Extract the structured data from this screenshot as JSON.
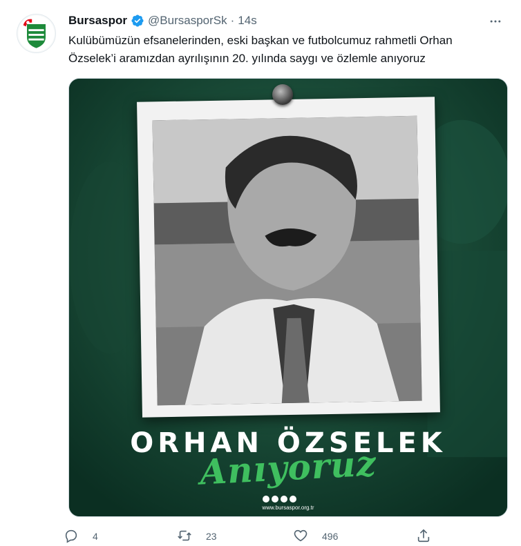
{
  "tweet": {
    "display_name": "Bursaspor",
    "handle": "@BursasporSk",
    "separator": "·",
    "time": "14s",
    "text": "Kulübümüzün efsanelerinden, eski başkan ve futbolcumuz rahmetli Orhan Özselek’i aramızdan ayrılışının 20. yılında saygı ve özlemle anıyoruz",
    "avatar_text": "BURSASPOR",
    "verified_icon": "verified-badge-icon",
    "more_icon": "more-horizontal-icon"
  },
  "media": {
    "title": "ORHAN ÖZSELEK",
    "script": "Anıyoruz",
    "site": "www.bursaspor.org.tr",
    "colors": {
      "background": "#0f3d2d",
      "accent": "#3fbf5f"
    }
  },
  "actions": {
    "reply": {
      "icon": "reply-icon",
      "count": "4"
    },
    "retweet": {
      "icon": "retweet-icon",
      "count": "23"
    },
    "like": {
      "icon": "heart-icon",
      "count": "496"
    },
    "share": {
      "icon": "share-icon"
    }
  },
  "colors": {
    "secondary_text": "#536471",
    "verified": "#1d9bf0"
  }
}
